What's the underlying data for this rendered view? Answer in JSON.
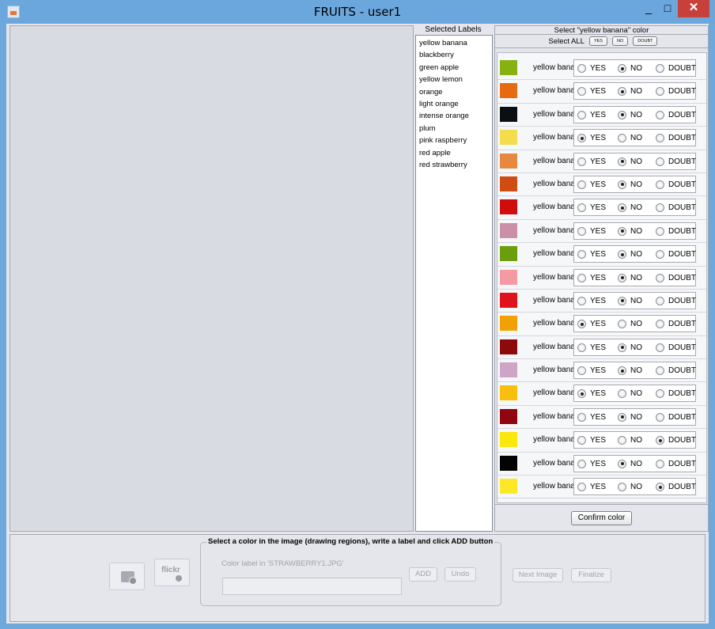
{
  "window": {
    "title": "FRUITS - user1",
    "min_glyph": "_",
    "max_glyph": "□",
    "close_glyph": "✕"
  },
  "labels_panel": {
    "header": "Selected Labels",
    "items": [
      "yellow banana",
      "blackberry",
      "green apple",
      "yellow lemon",
      "orange",
      "light orange",
      "intense orange",
      "plum",
      "pink raspberry",
      "red apple",
      "red strawberry"
    ]
  },
  "color_panel": {
    "header": "Select \"yellow banana\" color",
    "select_all_label": "Select ALL",
    "select_all_buttons": {
      "yes": "YES",
      "no": "NO",
      "doubt": "DOUBT"
    },
    "options": {
      "yes": "YES",
      "no": "NO",
      "doubt": "DOUBT"
    },
    "rows": [
      {
        "color": "#86b111",
        "label": "yellow banana",
        "selected": "NO"
      },
      {
        "color": "#e86a10",
        "label": "yellow banana",
        "selected": "NO"
      },
      {
        "color": "#0b0f14",
        "label": "yellow banana",
        "selected": "NO"
      },
      {
        "color": "#f4dd4c",
        "label": "yellow banana",
        "selected": "YES"
      },
      {
        "color": "#e6893e",
        "label": "yellow banana",
        "selected": "NO"
      },
      {
        "color": "#cf4c13",
        "label": "yellow banana",
        "selected": "NO"
      },
      {
        "color": "#d10c0c",
        "label": "yellow banana",
        "selected": "NO"
      },
      {
        "color": "#cc8fa8",
        "label": "yellow banana",
        "selected": "NO"
      },
      {
        "color": "#6b9e0c",
        "label": "yellow banana",
        "selected": "NO"
      },
      {
        "color": "#f59aa3",
        "label": "yellow banana",
        "selected": "NO"
      },
      {
        "color": "#e0131d",
        "label": "yellow banana",
        "selected": "NO"
      },
      {
        "color": "#f1a106",
        "label": "yellow banana",
        "selected": "YES"
      },
      {
        "color": "#8c0a0a",
        "label": "yellow banana",
        "selected": "NO"
      },
      {
        "color": "#cfa5c7",
        "label": "yellow banana",
        "selected": "NO"
      },
      {
        "color": "#f8bf0d",
        "label": "yellow banana",
        "selected": "YES"
      },
      {
        "color": "#8f0610",
        "label": "yellow banana",
        "selected": "NO"
      },
      {
        "color": "#fbe70b",
        "label": "yellow banana",
        "selected": "DOUBT"
      },
      {
        "color": "#030304",
        "label": "yellow banana",
        "selected": "NO"
      },
      {
        "color": "#fde726",
        "label": "yellow banana",
        "selected": "DOUBT"
      }
    ],
    "confirm_label": "Confirm color"
  },
  "bottom": {
    "flickr_text": "flickr",
    "legend": "Select a color in the image (drawing regions), write a label and click ADD button",
    "color_label_text": "Color label in 'STRAWBERRY1.JPG'",
    "input_value": "",
    "add_label": "ADD",
    "undo_label": "Undo",
    "next_label": "Next Image",
    "finalize_label": "Finalize"
  }
}
